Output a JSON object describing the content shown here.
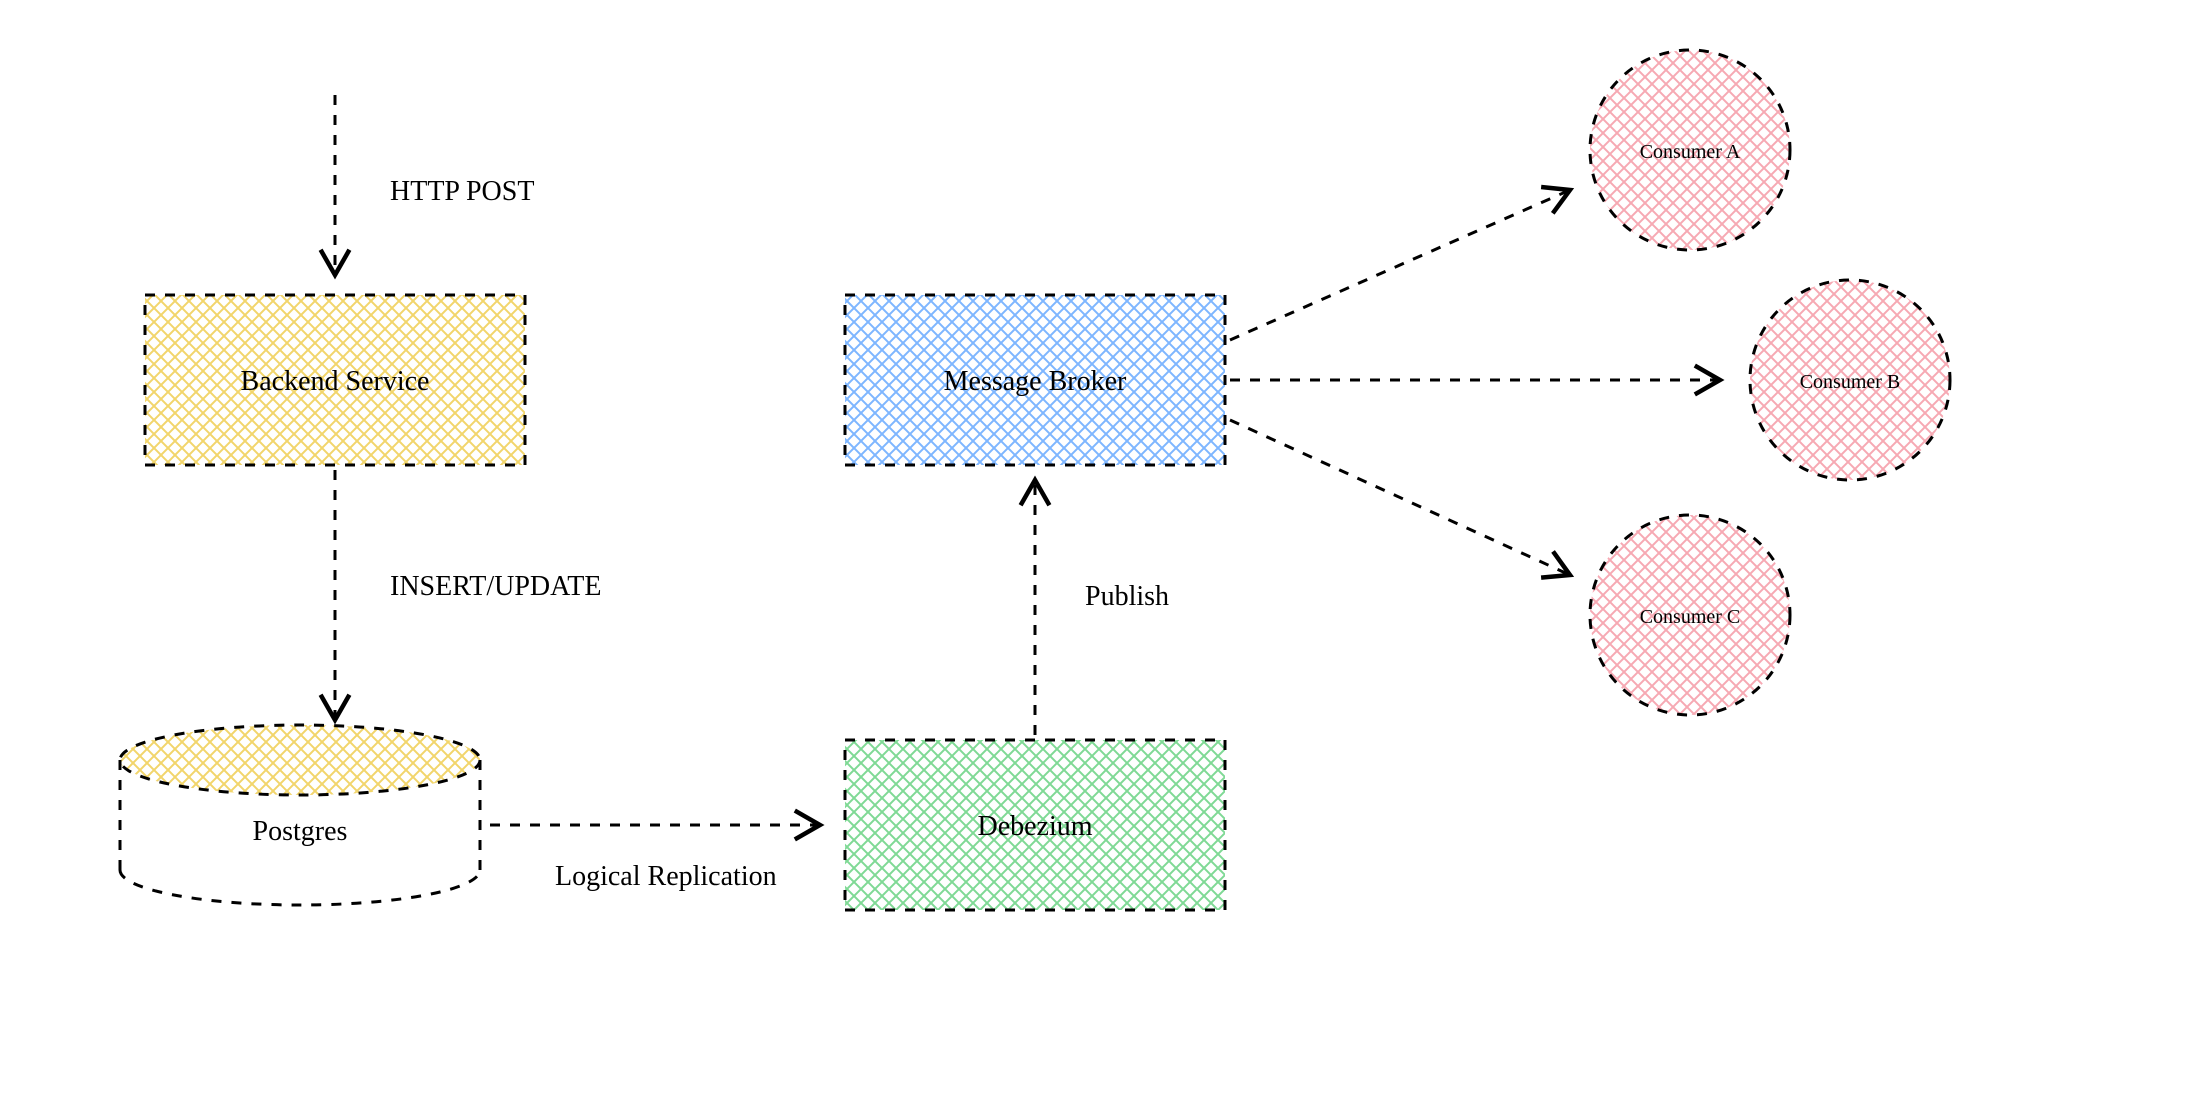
{
  "nodes": {
    "backend": "Backend Service",
    "postgres": "Postgres",
    "debezium": "Debezium",
    "broker": "Message Broker",
    "consumerA": "Consumer A",
    "consumerB": "Consumer B",
    "consumerC": "Consumer C"
  },
  "edges": {
    "http": "HTTP POST",
    "insert": "INSERT/UPDATE",
    "replication": "Logical Replication",
    "publish": "Publish"
  },
  "colors": {
    "yellow": "#f2d56b",
    "blue": "#7eb6ff",
    "green": "#7fd995",
    "red": "#f6a9b3",
    "stroke": "#000000"
  }
}
